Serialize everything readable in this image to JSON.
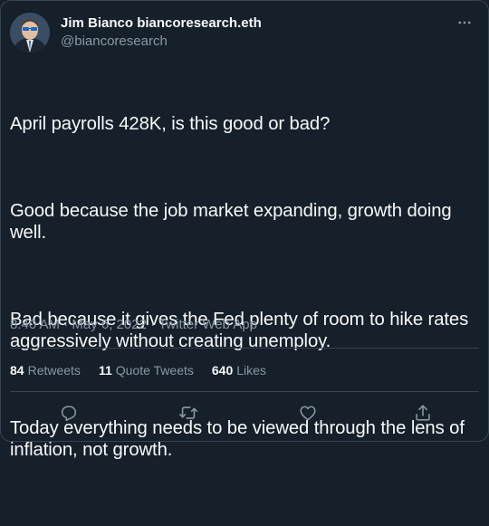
{
  "author": {
    "display_name": "Jim Bianco biancoresearch.eth",
    "handle": "@biancoresearch"
  },
  "tweet": {
    "paragraphs": [
      "April payrolls 428K, is this good or bad?",
      "Good because the job market expanding, growth doing well.",
      "Bad because it gives the Fed plenty of room to hike rates aggressively without creating unemploy.",
      "Today everything needs to be viewed through the lens of inflation, not growth."
    ],
    "meta": "8:40 AM · May 6, 2022 · Twitter Web App"
  },
  "stats": {
    "retweets_count": "84",
    "retweets_label": "Retweets",
    "quotes_count": "11",
    "quotes_label": "Quote Tweets",
    "likes_count": "640",
    "likes_label": "Likes"
  },
  "icons": {
    "more": "more-horizontal-icon",
    "reply": "reply-icon",
    "retweet": "retweet-icon",
    "like": "heart-icon",
    "share": "share-icon"
  },
  "colors": {
    "background": "#15202b",
    "text": "#f7f9f9",
    "secondary": "#8b98a5",
    "border": "#38444d"
  }
}
